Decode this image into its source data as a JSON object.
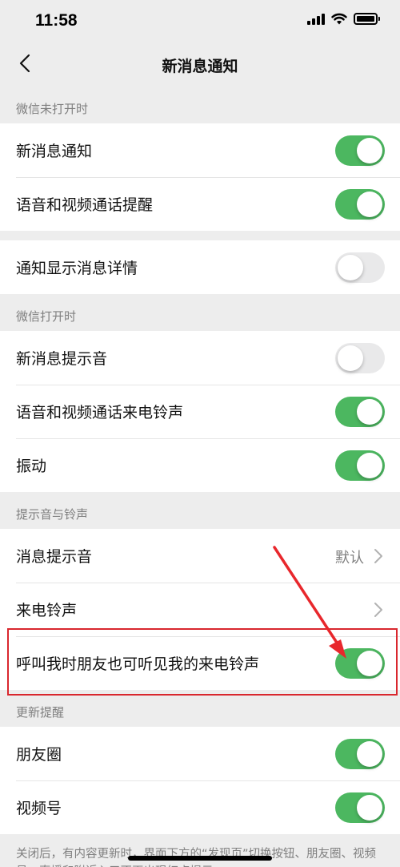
{
  "status_bar": {
    "time": "11:58"
  },
  "nav": {
    "title": "新消息通知"
  },
  "group_wechat_closed": {
    "header": "微信未打开时",
    "rows": [
      {
        "label": "新消息通知",
        "on": true
      },
      {
        "label": "语音和视频通话提醒",
        "on": true
      }
    ]
  },
  "group_detail": {
    "rows": [
      {
        "label": "通知显示消息详情",
        "on": false
      }
    ]
  },
  "group_wechat_open": {
    "header": "微信打开时",
    "rows": [
      {
        "label": "新消息提示音",
        "on": false
      },
      {
        "label": "语音和视频通话来电铃声",
        "on": true
      },
      {
        "label": "振动",
        "on": true
      }
    ]
  },
  "group_sounds": {
    "header": "提示音与铃声",
    "message_tone": {
      "label": "消息提示音",
      "value": "默认"
    },
    "ringtone": {
      "label": "来电铃声"
    },
    "share_ringtone": {
      "label": "呼叫我时朋友也可听见我的来电铃声",
      "on": true
    }
  },
  "group_updates": {
    "header": "更新提醒",
    "rows": [
      {
        "label": "朋友圈",
        "on": true
      },
      {
        "label": "视频号",
        "on": true
      }
    ]
  },
  "footer_note": "关闭后，有内容更新时，界面下方的“发现页”切换按钮、朋友圈、视频号、直播和附近入口不再出现红点提示",
  "colors": {
    "toggle_on": "#4cb760",
    "toggle_off": "#e9e9ea",
    "annotation_red": "#d9272e",
    "background": "#ededed"
  }
}
